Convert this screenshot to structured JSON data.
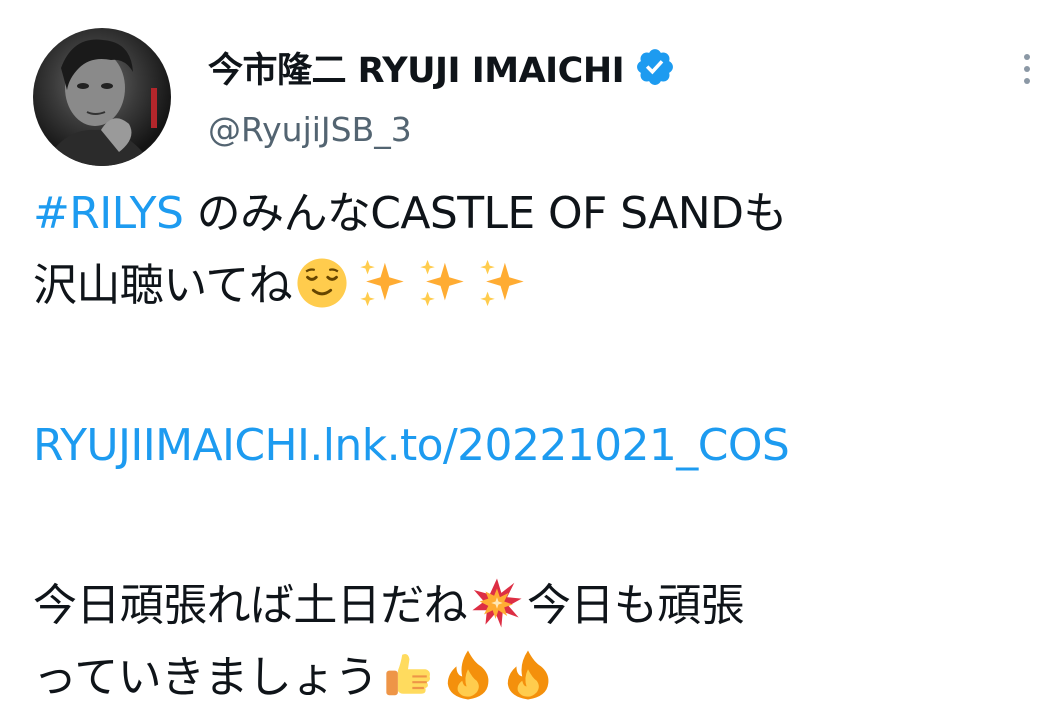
{
  "author": {
    "display_name": "今市隆二 RYUJI IMAICHI",
    "handle": "@RyujiJSB_3",
    "verified": true,
    "verified_icon": "verified-badge-icon"
  },
  "menu": {
    "icon": "more-vertical-icon"
  },
  "tweet": {
    "hashtag": "#RILYS",
    "line1_text": " のみんなCASTLE OF SANDも",
    "line2_text": "沢山聴いてね",
    "line2_emojis": [
      "relieved-face-emoji",
      "sparkles-emoji",
      "sparkles-emoji",
      "sparkles-emoji"
    ],
    "link": "RYUJIIMAICHI.lnk.to/20221021_COS",
    "line3_part1": "今日頑張れば土日だね",
    "line3_emoji": "collision-emoji",
    "line3_part2": "今日も頑張",
    "line4_text": "っていきましょう",
    "line4_emojis": [
      "thumbs-up-emoji",
      "fire-emoji",
      "fire-emoji"
    ]
  },
  "colors": {
    "link": "#1d9bf0",
    "text": "#0f1419",
    "secondary": "#536471",
    "verified": "#1d9bf0"
  }
}
